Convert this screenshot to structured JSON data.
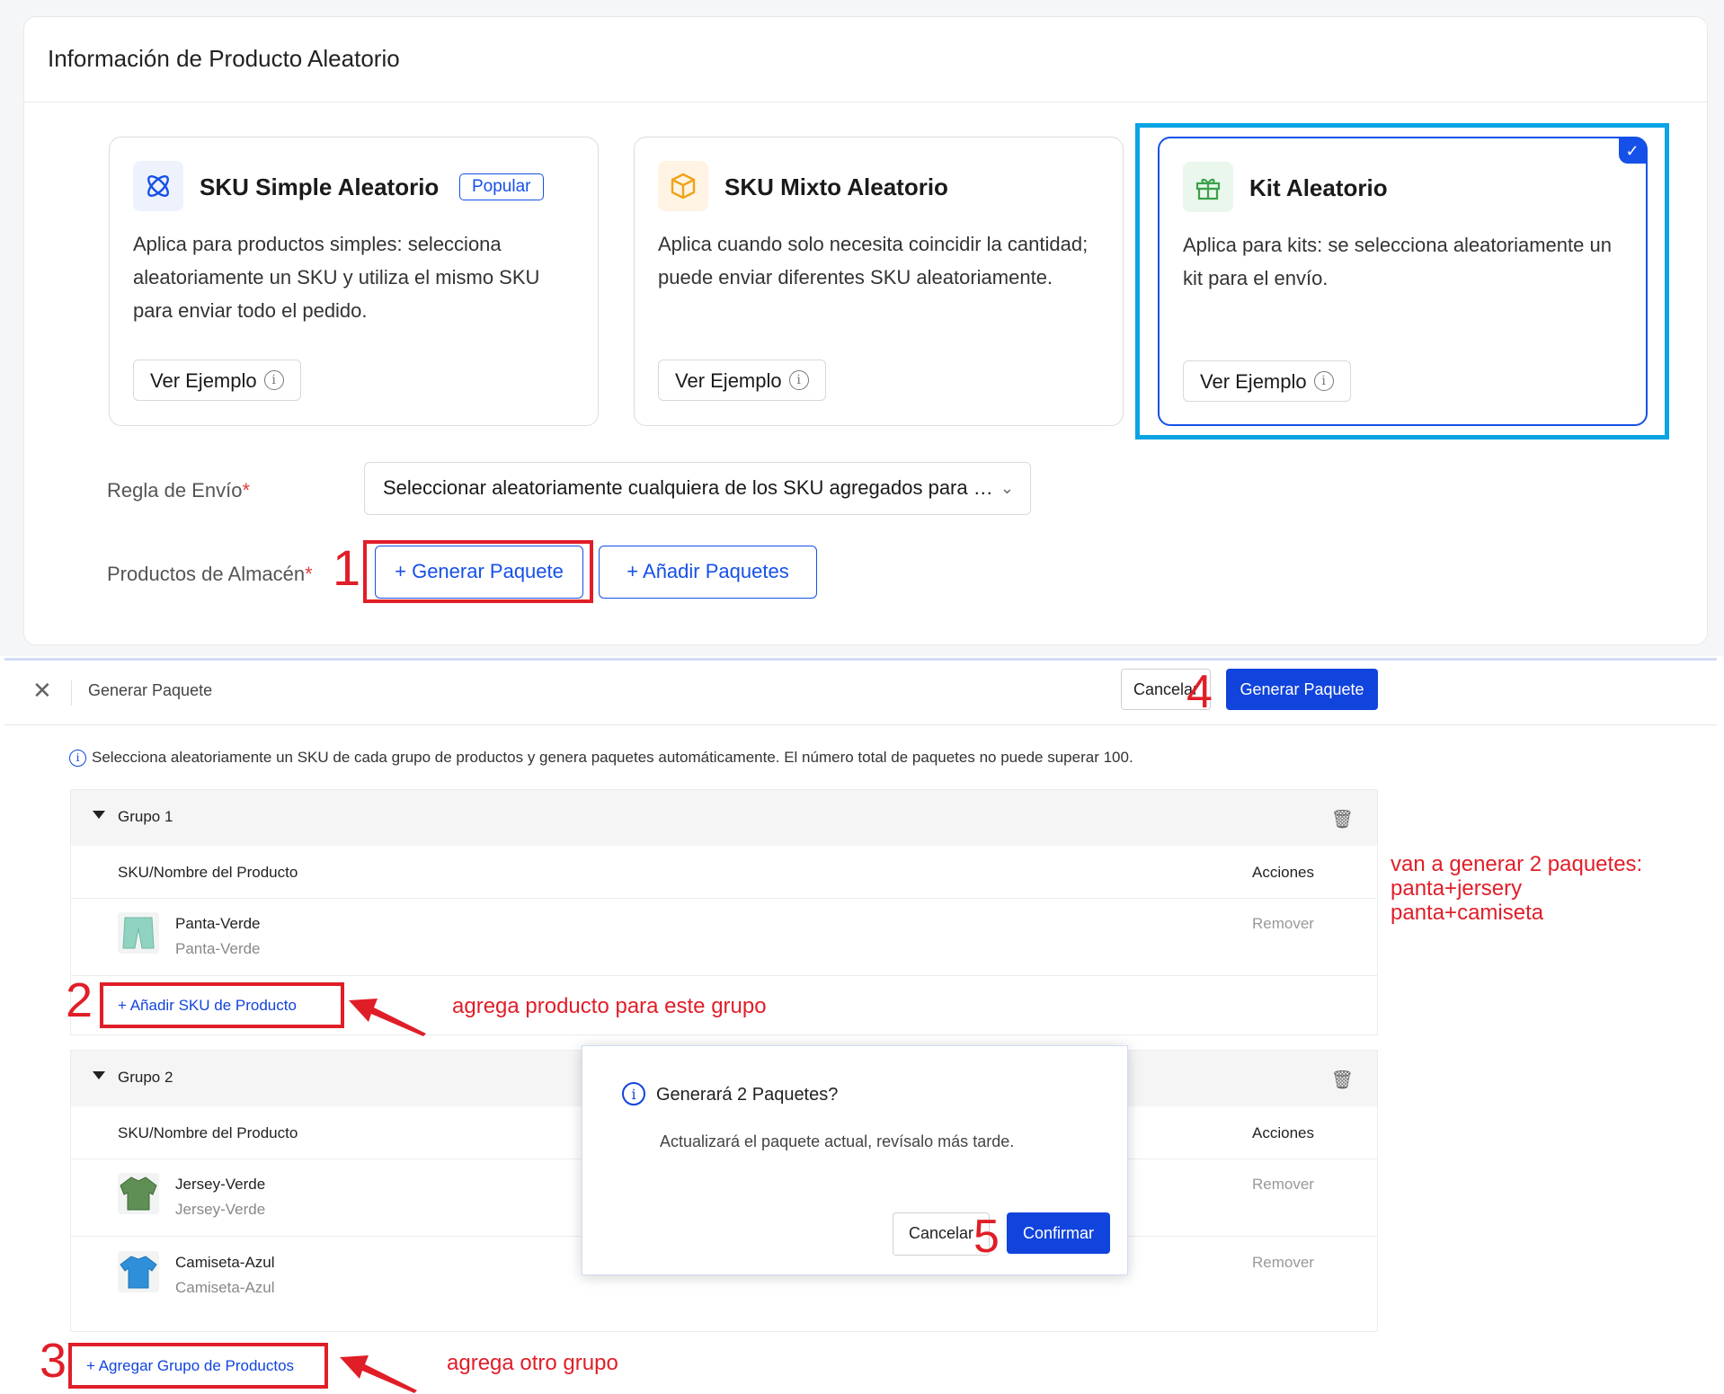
{
  "top": {
    "title": "Información de Producto Aleatorio",
    "options": [
      {
        "title": "SKU Simple Aleatorio",
        "badge": "Popular",
        "description": "Aplica para productos simples: selecciona aleatoriamente un SKU y utiliza el mismo SKU para enviar todo el pedido.",
        "button": "Ver Ejemplo",
        "icon": "atom-icon",
        "selected": false
      },
      {
        "title": "SKU Mixto Aleatorio",
        "badge": "",
        "description": "Aplica cuando solo necesita coincidir la cantidad; puede enviar diferentes SKU aleatoriamente.",
        "button": "Ver Ejemplo",
        "icon": "box-icon",
        "selected": false
      },
      {
        "title": "Kit Aleatorio",
        "badge": "",
        "description": "Aplica para kits: se selecciona aleatoriamente un kit para el envío.",
        "button": "Ver Ejemplo",
        "icon": "gift-icon",
        "selected": true
      }
    ],
    "shipping_rule_label": "Regla de Envío",
    "shipping_rule_value": "Seleccionar aleatoriamente cualquiera de los SKU agregados para envío",
    "warehouse_label": "Productos de Almacén",
    "generate_button": "+ Generar Paquete",
    "add_button": "+ Añadir Paquetes",
    "required_mark": "*"
  },
  "modal": {
    "title": "Generar Paquete",
    "cancel": "Cancelar",
    "confirm": "Generar Paquete",
    "notice": "Selecciona aleatoriamente un SKU de cada grupo de productos y genera paquetes automáticamente. El número total de paquetes no puede superar 100.",
    "col_product": "SKU/Nombre del Producto",
    "col_actions": "Acciones",
    "groups": [
      {
        "name": "Grupo 1",
        "products": [
          {
            "name": "Panta-Verde",
            "sku": "Panta-Verde",
            "action": "Remover"
          }
        ]
      },
      {
        "name": "Grupo 2",
        "products": [
          {
            "name": "Jersey-Verde",
            "sku": "Jersey-Verde",
            "action": "Remover"
          },
          {
            "name": "Camiseta-Azul",
            "sku": "Camiseta-Azul",
            "action": "Remover"
          }
        ]
      }
    ],
    "add_sku": "+ Añadir SKU de Producto",
    "add_group": "+ Agregar Grupo de Productos"
  },
  "dialog": {
    "title": "Generará 2 Paquetes?",
    "body": "Actualizará el paquete actual, revísalo más tarde.",
    "cancel": "Cancelar",
    "confirm": "Confirmar"
  },
  "annotations": {
    "n1": "1",
    "n2": "2",
    "n3": "3",
    "n4": "4",
    "n5": "5",
    "note_group": "agrega producto para este grupo",
    "note_other": "agrega otro grupo",
    "note_result_1": "van a generar 2 paquetes:",
    "note_result_2": "panta+jersery",
    "note_result_3": "panta+camiseta"
  },
  "colors": {
    "primary": "#1144dd",
    "annotation": "#e01e28",
    "highlight": "#0aa3e3"
  }
}
